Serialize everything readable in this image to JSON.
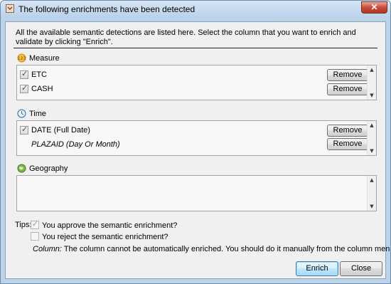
{
  "window": {
    "title": "The following enrichments have been detected",
    "close_glyph": "✕"
  },
  "description": "All the available semantic detections are listed here. Select the column that you want to enrich and validate by clicking \"Enrich\".",
  "sections": {
    "measure": {
      "label": "Measure",
      "icon": "measure-icon",
      "rows": [
        {
          "label": "ETC",
          "checked": true,
          "button": "Remove"
        },
        {
          "label": "CASH",
          "checked": true,
          "button": "Remove"
        }
      ]
    },
    "time": {
      "label": "Time",
      "icon": "clock-icon",
      "rows": [
        {
          "label": "DATE (Full Date)",
          "checked": true,
          "button": "Remove"
        },
        {
          "label": "PLAZAID (Day Or Month)",
          "checked": false,
          "button": "Remove"
        }
      ]
    },
    "geography": {
      "label": "Geography",
      "icon": "globe-icon",
      "rows": []
    }
  },
  "tips": {
    "label": "Tips:",
    "approve": "You approve the semantic enrichment?",
    "reject": "You reject the semantic enrichment?",
    "column_label": "Column:",
    "column_text": "The column cannot be automatically enriched. You should do it manually from the column menu."
  },
  "footer": {
    "enrich": "Enrich",
    "close": "Close"
  },
  "colors": {
    "titlebar": "#bcd3ea",
    "close": "#c94a38",
    "default_button": "#bee6fd"
  }
}
